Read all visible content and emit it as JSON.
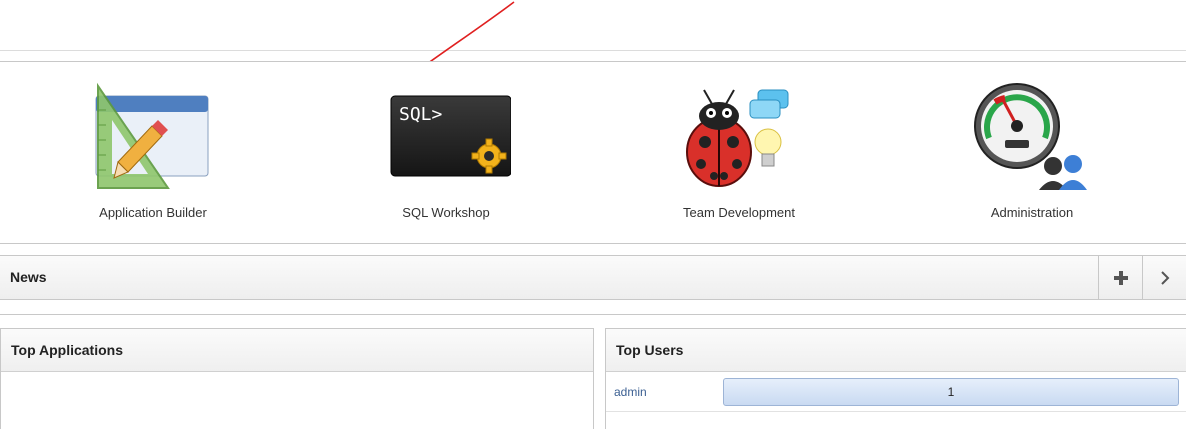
{
  "launcher": {
    "tiles": [
      {
        "label": "Application Builder",
        "icon": "application-builder-icon"
      },
      {
        "label": "SQL Workshop",
        "icon": "sql-workshop-icon",
        "icon_text": "SQL>"
      },
      {
        "label": "Team Development",
        "icon": "team-development-icon"
      },
      {
        "label": "Administration",
        "icon": "administration-icon"
      }
    ]
  },
  "news": {
    "title": "News",
    "add_icon": "plus-icon",
    "next_icon": "chevron-right-icon"
  },
  "top_applications": {
    "title": "Top Applications"
  },
  "top_users": {
    "title": "Top Users",
    "rows": [
      {
        "user": "admin",
        "count": "1"
      }
    ]
  },
  "colors": {
    "accent_bar": "#c9daf2",
    "link": "#3b5f92",
    "annotation": "#e02020"
  }
}
